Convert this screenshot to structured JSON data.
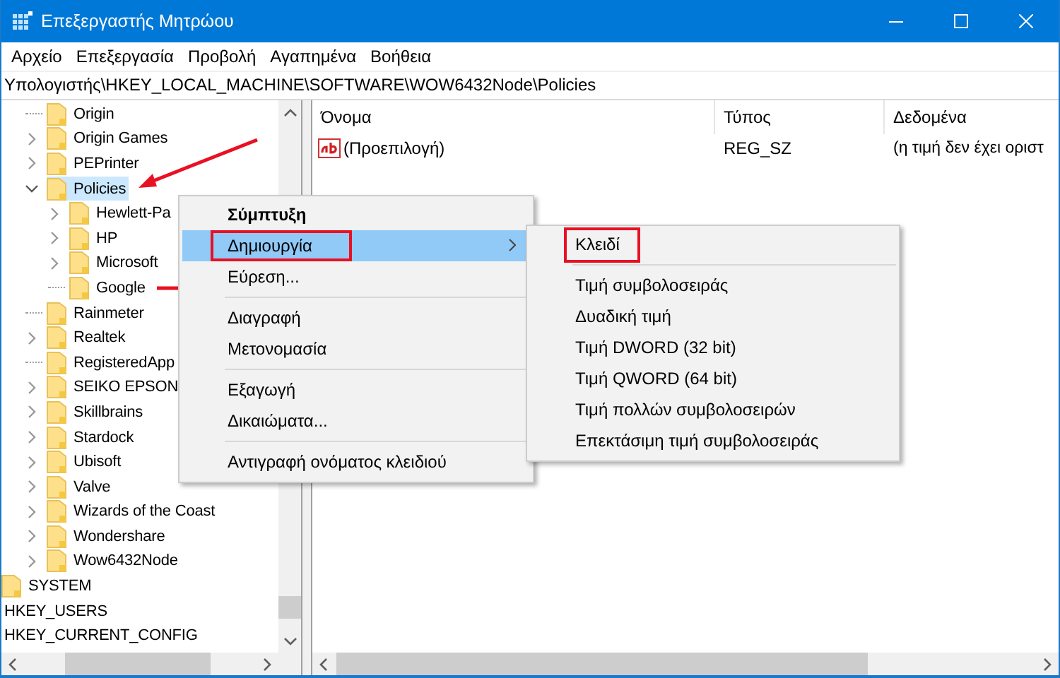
{
  "window": {
    "title": "Επεξεργαστής Μητρώου"
  },
  "menu_bar": [
    "Αρχείο",
    "Επεξεργασία",
    "Προβολή",
    "Αγαπημένα",
    "Βοήθεια"
  ],
  "address_bar": {
    "value": "Υπολογιστής\\HKEY_LOCAL_MACHINE\\SOFTWARE\\WOW6432Node\\Policies"
  },
  "tree": {
    "software_subkeys": [
      {
        "label": "Origin",
        "expandable": false,
        "selected": false
      },
      {
        "label": "Origin Games",
        "expandable": true,
        "expanded": false,
        "selected": false
      },
      {
        "label": "PEPrinter",
        "expandable": true,
        "expanded": false,
        "selected": false
      },
      {
        "label": "Policies",
        "expandable": true,
        "expanded": true,
        "selected": true,
        "arrow": {
          "kind": "diagonal"
        },
        "children": [
          {
            "label": "Hewlett-Pa",
            "expandable": true,
            "expanded": false,
            "selected": false
          },
          {
            "label": "HP",
            "expandable": true,
            "expanded": false,
            "selected": false
          },
          {
            "label": "Microsoft",
            "expandable": true,
            "expanded": false,
            "selected": false
          },
          {
            "label": "Google",
            "expandable": false,
            "selected": false,
            "arrow": {
              "kind": "left"
            }
          }
        ]
      },
      {
        "label": "Rainmeter",
        "expandable": false,
        "selected": false
      },
      {
        "label": "Realtek",
        "expandable": true,
        "expanded": false,
        "selected": false
      },
      {
        "label": "RegisteredApp",
        "expandable": false,
        "selected": false
      },
      {
        "label": "SEIKO EPSON",
        "expandable": true,
        "expanded": false,
        "selected": false
      },
      {
        "label": "Skillbrains",
        "expandable": true,
        "expanded": false,
        "selected": false
      },
      {
        "label": "Stardock",
        "expandable": true,
        "expanded": false,
        "selected": false
      },
      {
        "label": "Ubisoft",
        "expandable": true,
        "expanded": false,
        "selected": false
      },
      {
        "label": "Valve",
        "expandable": true,
        "expanded": false,
        "selected": false
      },
      {
        "label": "Wizards of the Coast",
        "expandable": true,
        "expanded": false,
        "selected": false
      },
      {
        "label": "Wondershare",
        "expandable": true,
        "expanded": false,
        "selected": false
      },
      {
        "label": "Wow6432Node",
        "expandable": true,
        "expanded": false,
        "selected": false
      }
    ],
    "hklm_subkeys": [
      {
        "label": "SYSTEM",
        "selected": false
      }
    ],
    "root_keys": [
      {
        "label": "HKEY_USERS",
        "selected": false
      },
      {
        "label": "HKEY_CURRENT_CONFIG",
        "selected": false
      }
    ]
  },
  "values": {
    "columns": [
      "Όνομα",
      "Τύπος",
      "Δεδομένα"
    ],
    "rows": [
      {
        "kind": "string",
        "name": "(Προεπιλογή)",
        "type": "REG_SZ",
        "data": "(η τιμή δεν έχει οριστ"
      }
    ]
  },
  "context_menu": {
    "items": [
      {
        "kind": "item",
        "label": "Σύμπτυξη",
        "default": true,
        "selected": false,
        "submenu": false,
        "marked": false
      },
      {
        "kind": "item",
        "label": "Δημιουργία",
        "default": false,
        "selected": true,
        "submenu": true,
        "marked": true
      },
      {
        "kind": "item",
        "label": "Εύρεση...",
        "default": false,
        "selected": false,
        "submenu": false,
        "marked": false
      },
      {
        "kind": "separator"
      },
      {
        "kind": "item",
        "label": "Διαγραφή",
        "default": false,
        "selected": false,
        "submenu": false,
        "marked": false
      },
      {
        "kind": "item",
        "label": "Μετονομασία",
        "default": false,
        "selected": false,
        "submenu": false,
        "marked": false
      },
      {
        "kind": "separator"
      },
      {
        "kind": "item",
        "label": "Εξαγωγή",
        "default": false,
        "selected": false,
        "submenu": false,
        "marked": false
      },
      {
        "kind": "item",
        "label": "Δικαιώματα...",
        "default": false,
        "selected": false,
        "submenu": false,
        "marked": false
      },
      {
        "kind": "separator"
      },
      {
        "kind": "item",
        "label": "Αντιγραφή ονόματος κλειδιού",
        "default": false,
        "selected": false,
        "submenu": false,
        "marked": false
      }
    ]
  },
  "submenu": {
    "items": [
      {
        "kind": "item",
        "label": "Κλειδί",
        "marked": true
      },
      {
        "kind": "separator"
      },
      {
        "kind": "item",
        "label": "Τιμή συμβολοσειράς",
        "marked": false
      },
      {
        "kind": "item",
        "label": "Δυαδική τιμή",
        "marked": false
      },
      {
        "kind": "item",
        "label": "Τιμή DWORD (32 bit)",
        "marked": false
      },
      {
        "kind": "item",
        "label": "Τιμή QWORD (64 bit)",
        "marked": false
      },
      {
        "kind": "item",
        "label": "Τιμή πολλών συμβολοσειρών",
        "marked": false
      },
      {
        "kind": "item",
        "label": "Επεκτάσιμη τιμή συμβολοσειράς",
        "marked": false
      }
    ]
  }
}
